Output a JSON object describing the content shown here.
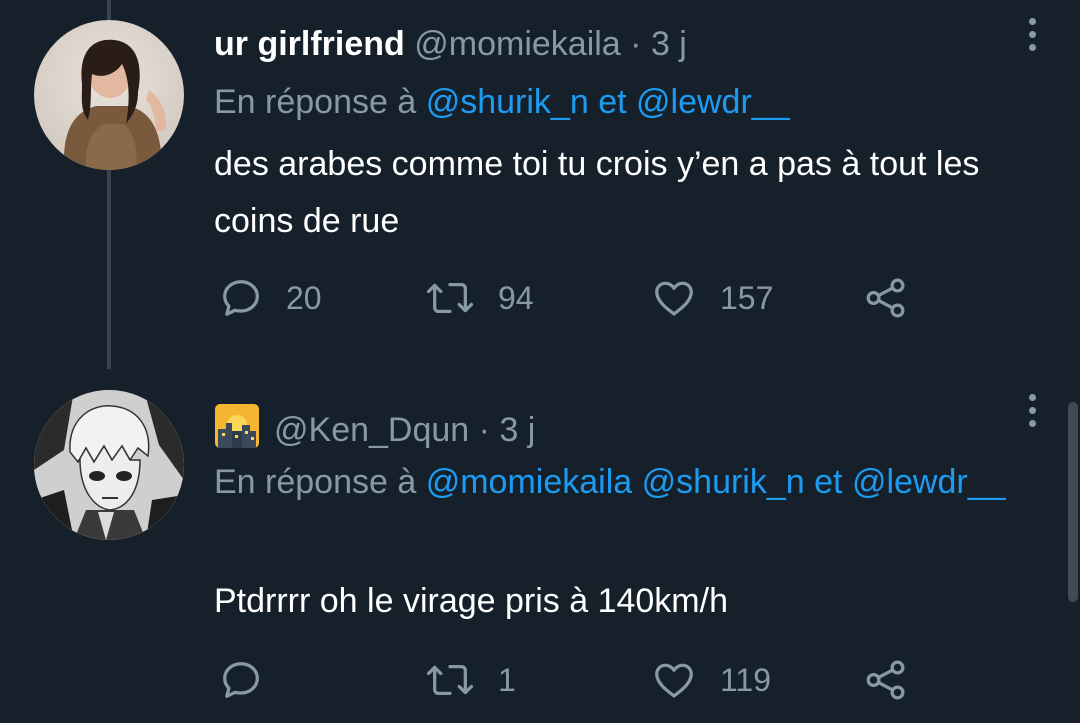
{
  "tweets": [
    {
      "display_name": "ur girlfriend",
      "handle": "@momiekaila",
      "separator": "·",
      "time": "3 j",
      "reply_prefix": "En réponse à",
      "reply_mentions": [
        "@shurik_n",
        "@lewdr__"
      ],
      "reply_joiner": "et",
      "text": "des arabes comme toi tu crois y’en a pas à tout les coins de rue",
      "replies": "20",
      "retweets": "94",
      "likes": "157",
      "avatar": "avatar-photo"
    },
    {
      "display_name_emoji": "night-city-emoji",
      "handle": "@Ken_Dqun",
      "separator": "·",
      "time": "3 j",
      "reply_prefix": "En réponse à",
      "reply_mentions": [
        "@momiekaila",
        "@shurik_n",
        "@lewdr__"
      ],
      "reply_joiner": "et",
      "text": "Ptdrrrr oh le virage pris à 140km/h",
      "replies": "",
      "retweets": "1",
      "likes": "119",
      "avatar": "manga-avatar"
    }
  ],
  "icons": {
    "reply": "reply-icon",
    "retweet": "retweet-icon",
    "like": "heart-icon",
    "share": "share-icon",
    "more": "more-icon"
  },
  "colors": {
    "background": "#15202b",
    "text": "#ffffff",
    "secondary": "#8899a6",
    "link": "#1d9bf0",
    "thread_line": "#38444d"
  }
}
